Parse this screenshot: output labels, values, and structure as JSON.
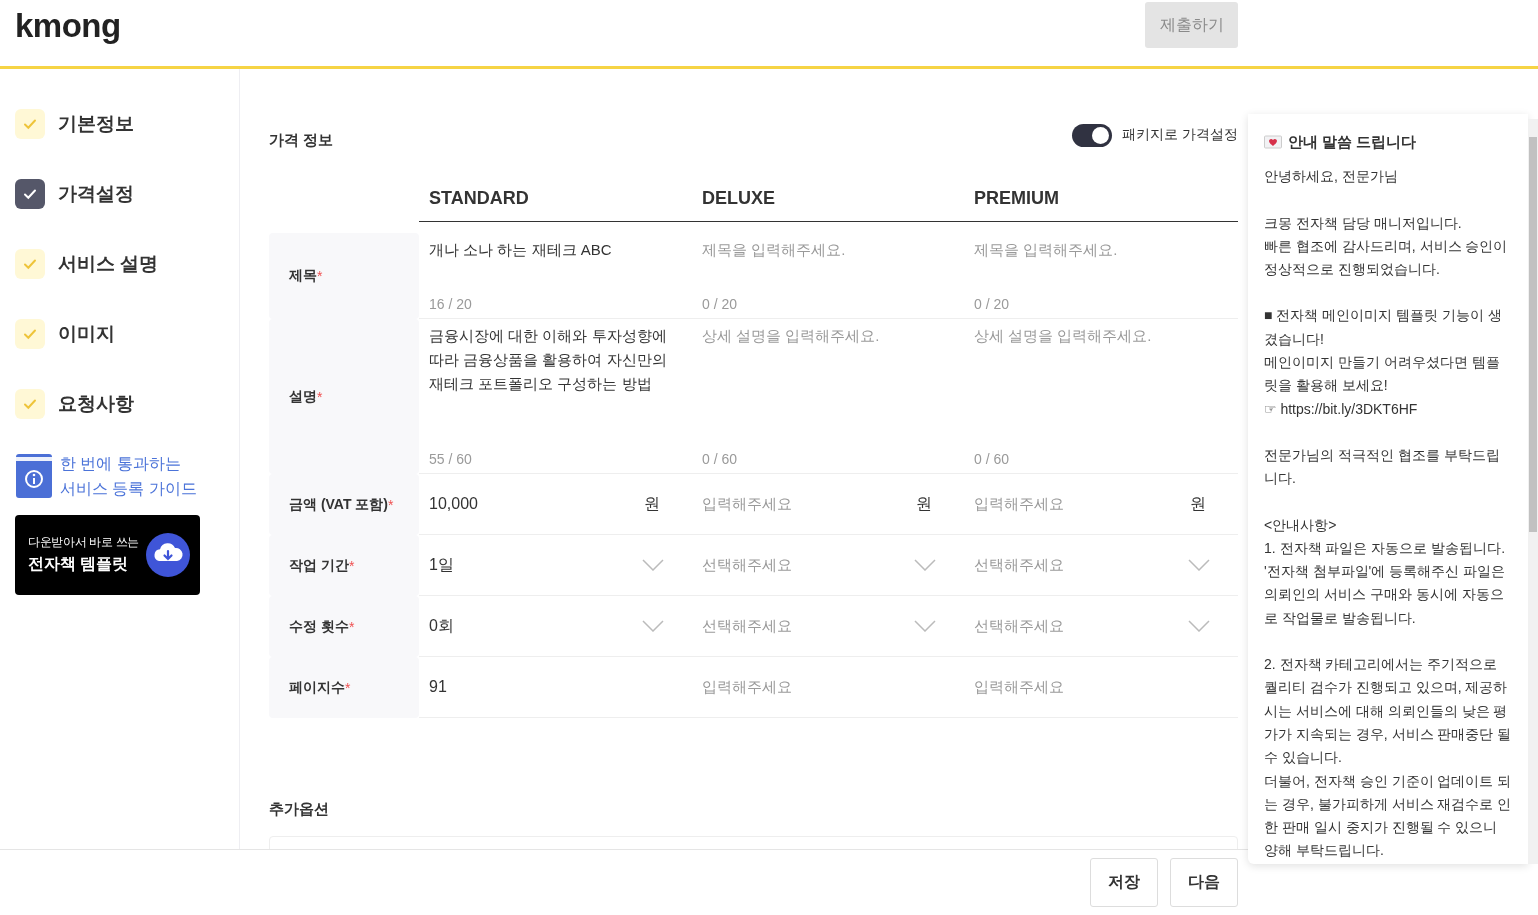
{
  "header": {
    "logo": "kmong",
    "submit_button": {
      "label": "제출하기",
      "disabled": true
    }
  },
  "sidebar": {
    "steps": [
      {
        "label": "기본정보",
        "selected": false,
        "completed": true
      },
      {
        "label": "가격설정",
        "selected": true,
        "completed": true
      },
      {
        "label": "서비스 설명",
        "selected": false,
        "completed": true
      },
      {
        "label": "이미지",
        "selected": false,
        "completed": true
      },
      {
        "label": "요청사항",
        "selected": false,
        "completed": true
      }
    ],
    "guide": {
      "lines": [
        "한 번에 통과하는",
        "서비스 등록 가이드"
      ]
    },
    "template_banner": {
      "subtitle": "다운받아서 바로 쓰는",
      "title": "전자책 템플릿"
    }
  },
  "pricing": {
    "title": "가격 정보",
    "package_toggle": {
      "label": "패키지로 가격설정",
      "on": true
    },
    "columns": [
      "STANDARD",
      "DELUXE",
      "PREMIUM"
    ],
    "rows": [
      {
        "label": "제목",
        "required_mark": "*",
        "kind": "text",
        "cells": [
          {
            "value": "개나 소나 하는 재테크 ABC",
            "counter": "16 / 20"
          },
          {
            "placeholder": "제목을 입력해주세요.",
            "counter": "0 / 20"
          },
          {
            "placeholder": "제목을 입력해주세요.",
            "counter": "0 / 20"
          }
        ]
      },
      {
        "label": "설명",
        "required_mark": "*",
        "kind": "textarea",
        "cells": [
          {
            "value": "금융시장에 대한 이해와 투자성향에 따라 금융상품을 활용하여 자신만의 재테크 포트폴리오 구성하는 방법",
            "counter": "55 / 60"
          },
          {
            "placeholder": "상세 설명을 입력해주세요.",
            "counter": "0 / 60"
          },
          {
            "placeholder": "상세 설명을 입력해주세요.",
            "counter": "0 / 60"
          }
        ]
      },
      {
        "label": "금액 (VAT 포함)",
        "required_mark": "*",
        "kind": "price",
        "cells": [
          {
            "value": "10,000",
            "unit": "원"
          },
          {
            "placeholder": "입력해주세요",
            "unit": "원"
          },
          {
            "placeholder": "입력해주세요",
            "unit": "원"
          }
        ]
      },
      {
        "label": "작업 기간",
        "required_mark": "*",
        "kind": "select",
        "cells": [
          {
            "value": "1일"
          },
          {
            "placeholder": "선택해주세요"
          },
          {
            "placeholder": "선택해주세요"
          }
        ]
      },
      {
        "label": "수정 횟수",
        "required_mark": "*",
        "kind": "select",
        "cells": [
          {
            "value": "0회"
          },
          {
            "placeholder": "선택해주세요"
          },
          {
            "placeholder": "선택해주세요"
          }
        ]
      },
      {
        "label": "페이지수",
        "required_mark": "*",
        "kind": "number",
        "cells": [
          {
            "value": "91"
          },
          {
            "placeholder": "입력해주세요"
          },
          {
            "placeholder": "입력해주세요"
          }
        ]
      }
    ],
    "extra_options_title": "추가옵션"
  },
  "notice": {
    "title": "안내 말씀 드립니다",
    "paragraphs": [
      [
        "안녕하세요, 전문가님"
      ],
      [
        "크몽 전자책 담당 매니저입니다.",
        "빠른 협조에 감사드리며, 서비스 승인이 정상적으로 진행되었습니다."
      ],
      [
        "■ 전자책 메인이미지 템플릿 기능이 생겼습니다!",
        "메인이미지 만들기 어려우셨다면 템플릿을 활용해 보세요!",
        "☞ https://bit.ly/3DKT6HF"
      ],
      [
        "전문가님의 적극적인 협조를 부탁드립니다."
      ],
      [
        "<안내사항>",
        "1. 전자책 파일은 자동으로 발송됩니다.",
        "'전자책 첨부파일'에 등록해주신 파일은 의뢰인의 서비스 구매와 동시에 자동으로 작업물로 발송됩니다."
      ],
      [
        "2. 전자책 카테고리에서는 주기적으로 퀄리티 검수가 진행되고 있으며, 제공하시는 서비스에 대해 의뢰인들의 낮은 평가가 지속되는 경우, 서비스 판매중단 될 수 있습니다.",
        "더불어, 전자책 승인 기준이 업데이트 되는 경우, 불가피하게 서비스 재검수로 인한 판매 일시 중지가 진행될 수 있으니 양해 부탁드립니다."
      ]
    ]
  },
  "footer": {
    "buttons": [
      "저장",
      "다음"
    ]
  }
}
